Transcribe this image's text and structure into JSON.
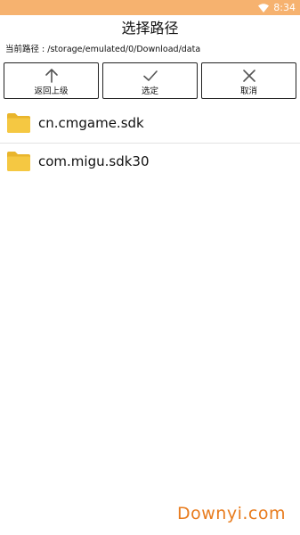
{
  "status_bar": {
    "time": "8:34",
    "icons": [
      "wifi-icon"
    ],
    "background_color": "#f6b26f"
  },
  "header": {
    "title": "选择路径"
  },
  "path": {
    "label": "当前路径 : /storage/emulated/0/Download/data"
  },
  "toolbar": {
    "buttons": [
      {
        "label": "返回上级",
        "icon": "arrow-up-icon"
      },
      {
        "label": "选定",
        "icon": "check-icon"
      },
      {
        "label": "取消",
        "icon": "close-icon"
      }
    ]
  },
  "files": [
    {
      "name": "cn.cmgame.sdk",
      "icon": "folder-icon"
    },
    {
      "name": "com.migu.sdk30",
      "icon": "folder-icon"
    }
  ],
  "watermark": {
    "text": "Downyi.com",
    "color": "#e87c1e"
  },
  "colors": {
    "folder": "#f5c842",
    "folder_back": "#e9b52c"
  }
}
